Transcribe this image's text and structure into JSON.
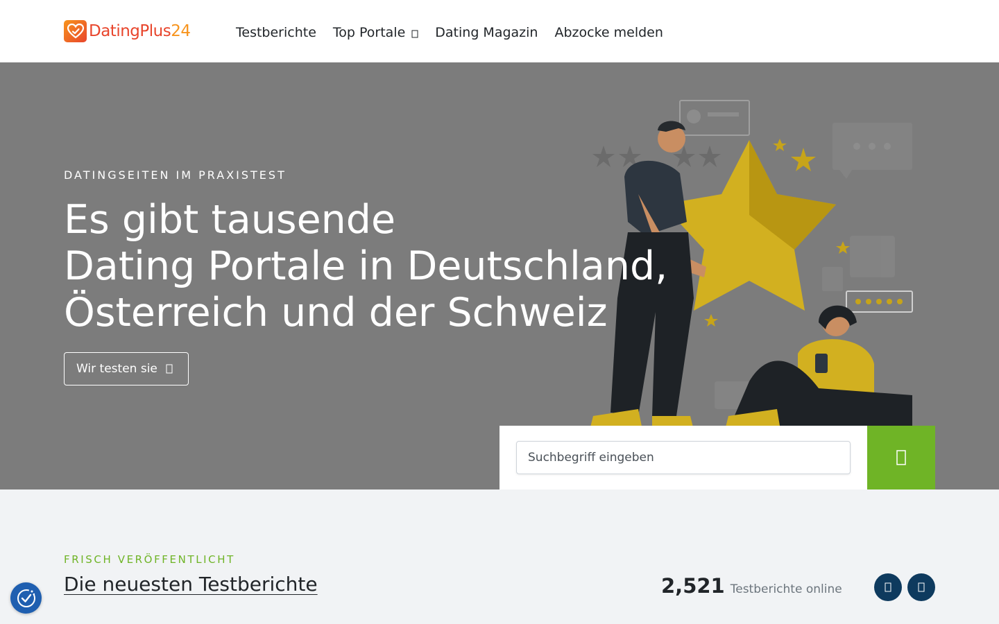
{
  "header": {
    "logo": {
      "part1": "DatingPlus",
      "part2": "24"
    },
    "nav": [
      {
        "label": "Testberichte"
      },
      {
        "label": "Top Portale",
        "has_dropdown": true
      },
      {
        "label": "Dating Magazin"
      },
      {
        "label": "Abzocke melden"
      }
    ]
  },
  "hero": {
    "eyebrow": "DATINGSEITEN IM PRAXISTEST",
    "title_lines": [
      "Es gibt tausende",
      "Dating Portale in Deutschland,",
      "Österreich und der Schweiz"
    ],
    "cta_label": "Wir testen sie",
    "illustration": "people-rating-star-illustration"
  },
  "search": {
    "placeholder": "Suchbegriff eingeben",
    "button_icon": "search-icon"
  },
  "latest": {
    "eyebrow": "FRISCH VERÖFFENTLICHT",
    "title": "Die neuesten Testberichte",
    "count": "2,521",
    "count_label": "Testberichte online",
    "prev_icon": "arrow-left-icon",
    "next_icon": "arrow-right-icon"
  },
  "cookie_button": {
    "icon": "cookie-consent-icon"
  },
  "colors": {
    "accent_green": "#6fb426",
    "navy": "#0e3a5e",
    "hero_bg": "#7c7c7c",
    "logo_red": "#e8452c",
    "logo_orange": "#f7941d",
    "cookie_blue": "#1f5fb0"
  }
}
